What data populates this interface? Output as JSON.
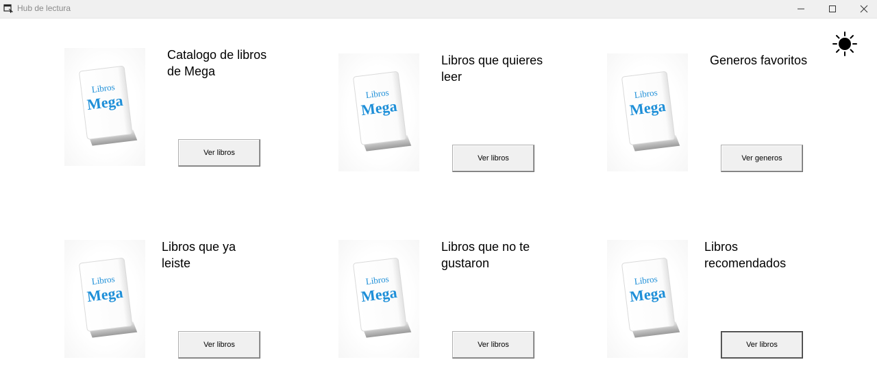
{
  "window": {
    "title": "Hub de lectura",
    "icons": [
      "app-window-icon",
      "minimize-icon",
      "maximize-icon",
      "close-icon"
    ]
  },
  "theme_toggle": {
    "icon": "sun-icon"
  },
  "book_cover": {
    "line1": "Libros",
    "line2": "Mega",
    "brand_color": "#1e8fd8"
  },
  "cards": [
    {
      "title": "Catalogo de libros de Mega",
      "button": "Ver libros"
    },
    {
      "title": "Libros que quieres leer",
      "button": "Ver libros"
    },
    {
      "title": "Generos favoritos",
      "button": "Ver generos"
    },
    {
      "title": "Libros que ya leiste",
      "button": "Ver libros"
    },
    {
      "title": "Libros que no te gustaron",
      "button": "Ver libros"
    },
    {
      "title": "Libros recomendados",
      "button": "Ver libros"
    }
  ]
}
